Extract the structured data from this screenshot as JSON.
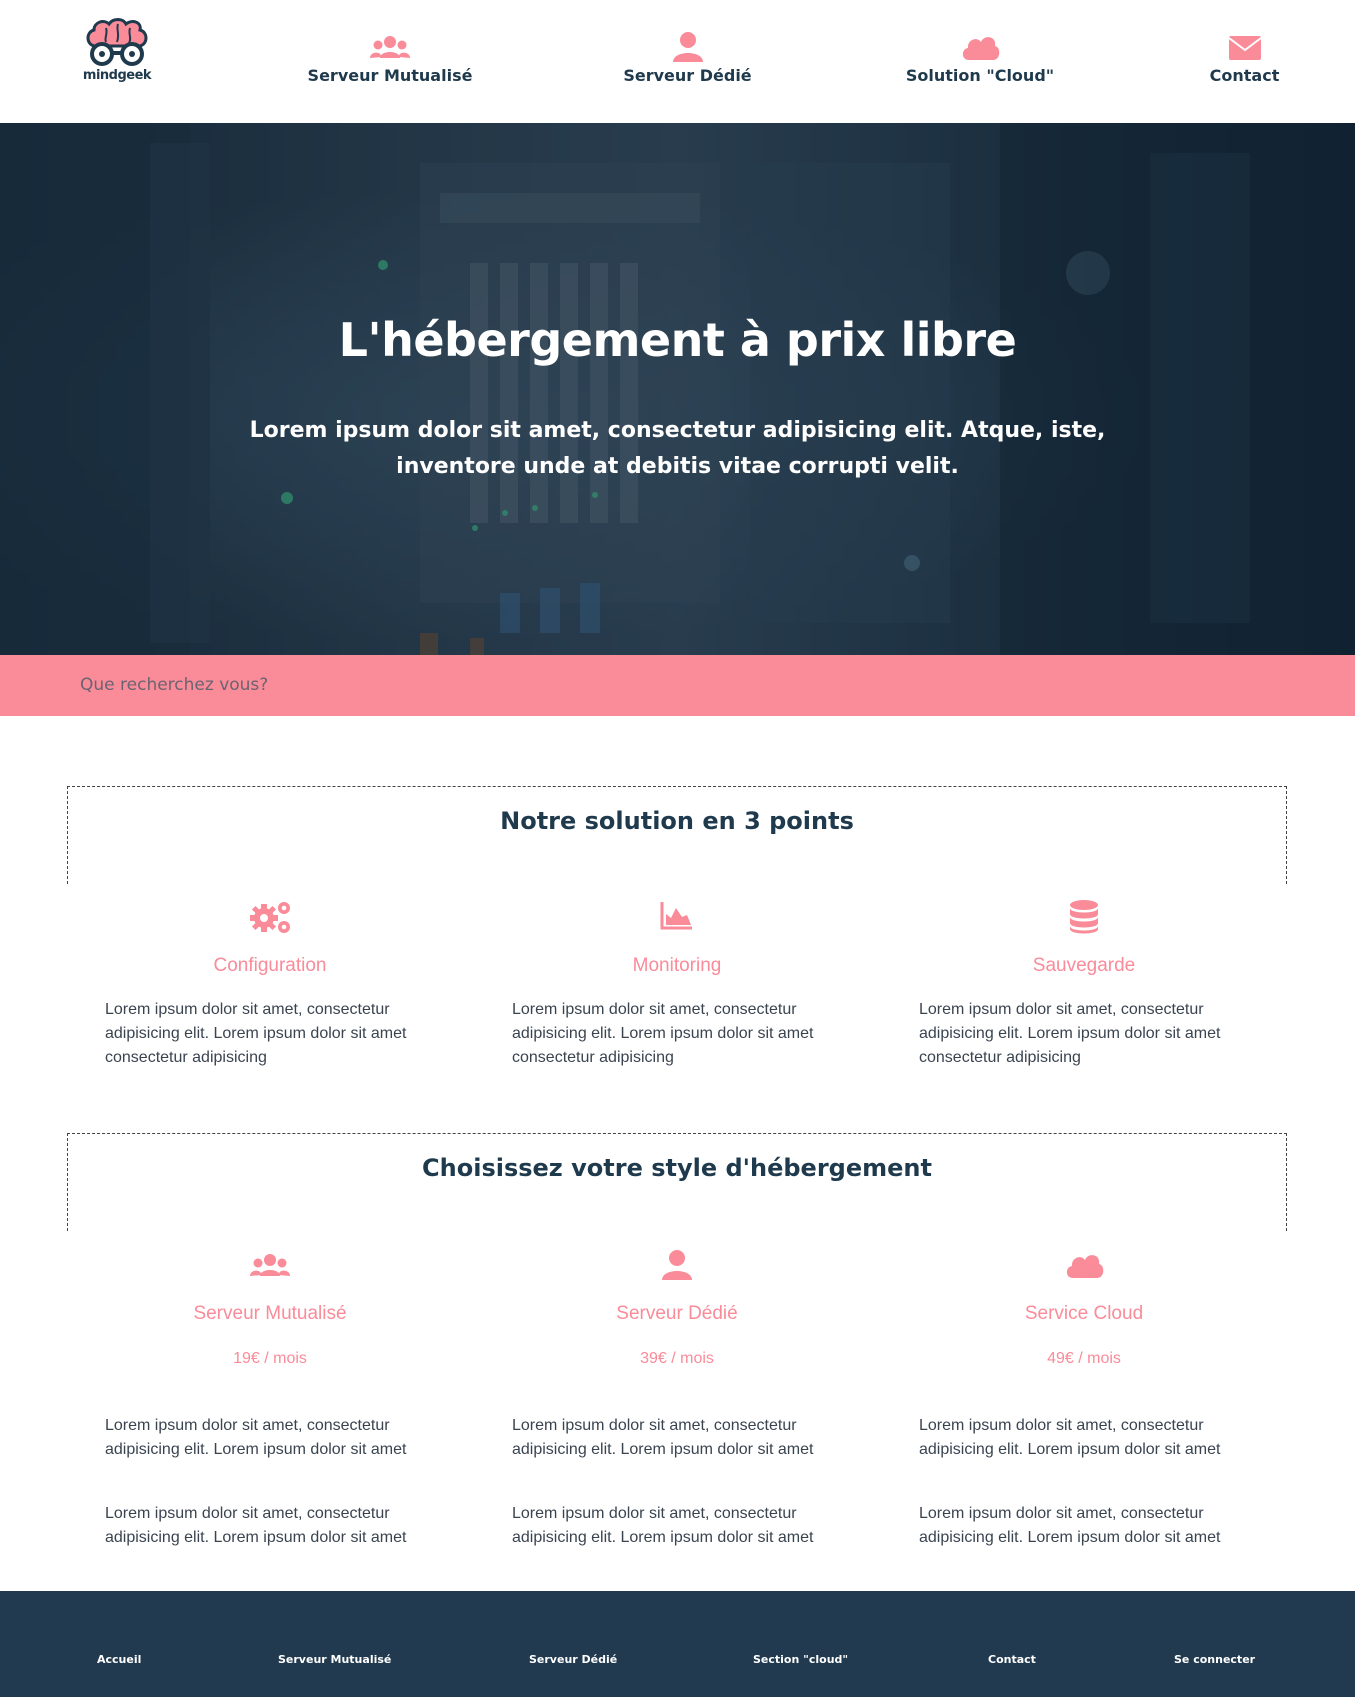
{
  "brand": {
    "logo_text": "mindgeek",
    "accent_color": "#fa8b99",
    "dark_color": "#1f3a4d"
  },
  "nav": {
    "items": [
      {
        "label": "Serveur Mutualisé",
        "icon": "users-icon"
      },
      {
        "label": "Serveur Dédié",
        "icon": "user-icon"
      },
      {
        "label": "Solution \"Cloud\"",
        "icon": "cloud-icon"
      },
      {
        "label": "Contact",
        "icon": "envelope-icon"
      }
    ]
  },
  "hero": {
    "title": "L'hébergement à prix libre",
    "subtitle": "Lorem ipsum dolor sit amet, consectetur adipisicing elit. Atque, iste, inventore unde at debitis vitae corrupti velit."
  },
  "search": {
    "placeholder": "Que recherchez vous?"
  },
  "features": {
    "title": "Notre solution en 3 points",
    "items": [
      {
        "icon": "cogs-icon",
        "title": "Configuration",
        "text": "Lorem ipsum dolor sit amet, consectetur adipisicing elit. Lorem ipsum dolor sit amet consectetur adipisicing"
      },
      {
        "icon": "area-chart-icon",
        "title": "Monitoring",
        "text": "Lorem ipsum dolor sit amet, consectetur adipisicing elit. Lorem ipsum dolor sit amet consectetur adipisicing"
      },
      {
        "icon": "database-icon",
        "title": "Sauvegarde",
        "text": "Lorem ipsum dolor sit amet, consectetur adipisicing elit. Lorem ipsum dolor sit amet consectetur adipisicing"
      }
    ]
  },
  "hosting": {
    "title": "Choisissez votre style d'hébergement",
    "items": [
      {
        "icon": "users-icon",
        "title": "Serveur Mutualisé",
        "price": "19€ / mois",
        "text1": "Lorem ipsum dolor sit amet, consectetur adipisicing elit. Lorem ipsum dolor sit amet",
        "text2": "Lorem ipsum dolor sit amet, consectetur adipisicing elit. Lorem ipsum dolor sit amet"
      },
      {
        "icon": "user-icon",
        "title": "Serveur Dédié",
        "price": "39€ / mois",
        "text1": "Lorem ipsum dolor sit amet, consectetur adipisicing elit. Lorem ipsum dolor sit amet",
        "text2": "Lorem ipsum dolor sit amet, consectetur adipisicing elit. Lorem ipsum dolor sit amet"
      },
      {
        "icon": "cloud-icon",
        "title": "Service Cloud",
        "price": "49€ / mois",
        "text1": "Lorem ipsum dolor sit amet, consectetur adipisicing elit. Lorem ipsum dolor sit amet",
        "text2": "Lorem ipsum dolor sit amet, consectetur adipisicing elit. Lorem ipsum dolor sit amet"
      }
    ]
  },
  "footer": {
    "links": [
      "Accueil",
      "Serveur Mutualisé",
      "Serveur Dédié",
      "Section \"cloud\"",
      "Contact",
      "Se connecter"
    ]
  }
}
